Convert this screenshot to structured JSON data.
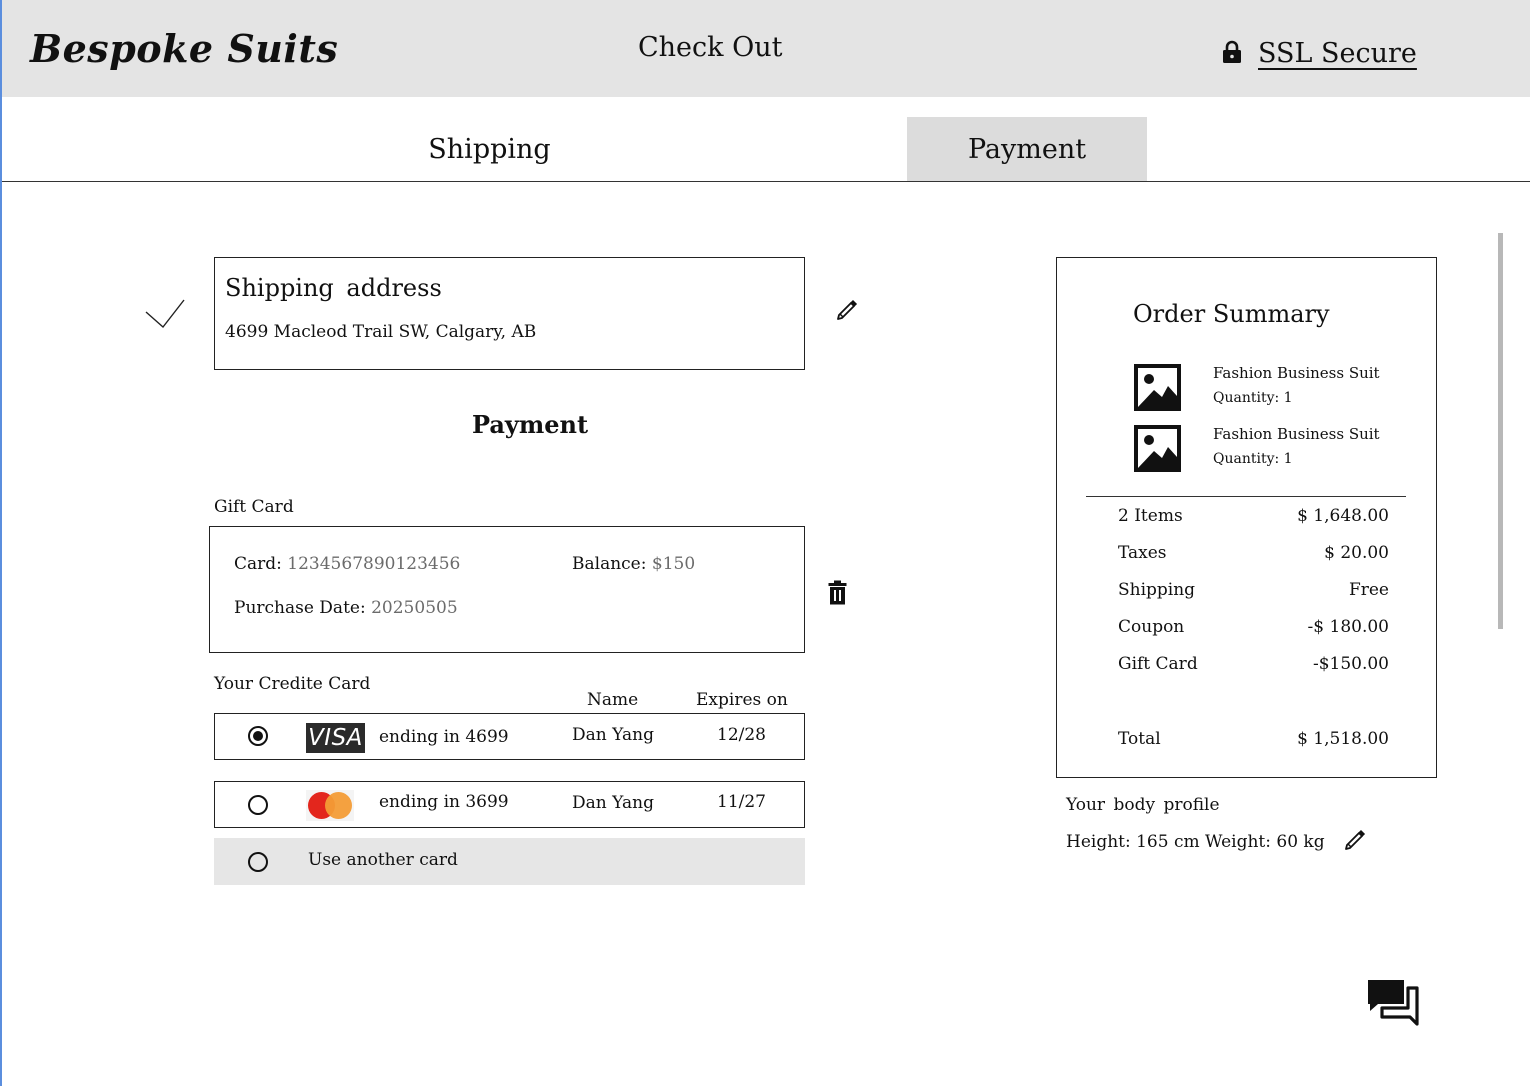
{
  "header": {
    "brand": "Bespoke Suits",
    "title": "Check Out",
    "secure_label": "SSL Secure",
    "lock_icon": "lock-icon"
  },
  "tabs": [
    {
      "label": "Shipping",
      "active": false
    },
    {
      "label": "Payment",
      "active": true
    }
  ],
  "shipping": {
    "title": "Shipping  address",
    "address": "4699 Macleod Trail SW, Calgary, AB",
    "status_icon": "checkmark-icon",
    "edit_icon": "pencil-icon"
  },
  "payment": {
    "heading": "Payment",
    "gift_card": {
      "section_label": "Gift Card",
      "card_label": "Card:",
      "card_number": "1234567890123456",
      "balance_label": "Balance:",
      "balance": "$150",
      "date_label": "Purchase Date:",
      "date": "20250505",
      "delete_icon": "trash-icon"
    },
    "credit": {
      "section_label": "Your Credite Card",
      "col_name": "Name",
      "col_expires": "Expires on",
      "cards": [
        {
          "brand": "VISA",
          "ending": "ending in 4699",
          "name": "Dan Yang",
          "expires": "12/28",
          "selected": true
        },
        {
          "brand": "mastercard",
          "ending": "ending in 3699",
          "name": "Dan Yang",
          "expires": "11/27",
          "selected": false
        }
      ],
      "another_label": "Use another card"
    }
  },
  "summary": {
    "title": "Order Summary",
    "items": [
      {
        "name": "Fashion Business Suit",
        "quantity": "Quantity: 1"
      },
      {
        "name": "Fashion Business Suit",
        "quantity": "Quantity: 1"
      }
    ],
    "rows": [
      {
        "label": "2 Items",
        "value": "$ 1,648.00"
      },
      {
        "label": "Taxes",
        "value": "$ 20.00"
      },
      {
        "label": "Shipping",
        "value": "Free"
      },
      {
        "label": "Coupon",
        "value": "-$ 180.00"
      },
      {
        "label": "Gift Card",
        "value": "-$150.00"
      }
    ],
    "total_label": "Total",
    "total_value": "$ 1,518.00"
  },
  "body_profile": {
    "title": "Your  body profile",
    "details": "Height:  165 cm  Weight: 60 kg"
  },
  "colors": {
    "header_bg": "#e4e4e4",
    "active_tab_bg": "#dcdcdc",
    "muted_text": "#6b6b6b"
  },
  "chat_icon": "chat-bubbles-icon"
}
